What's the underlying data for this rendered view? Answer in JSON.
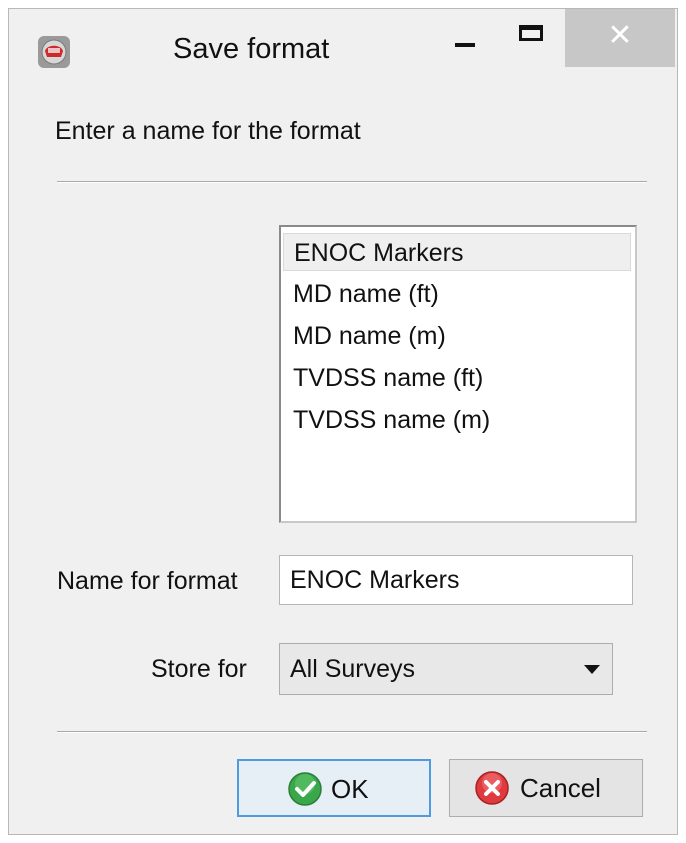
{
  "window": {
    "title": "Save format",
    "close_glyph": "✕"
  },
  "prompt": "Enter a name for the format",
  "format_list": {
    "items": [
      "ENOC Markers",
      "MD name (ft)",
      "MD name (m)",
      "TVDSS name (ft)",
      "TVDSS name (m)"
    ],
    "selected_index": 0
  },
  "name_field": {
    "label": "Name for format",
    "value": "ENOC Markers"
  },
  "store_field": {
    "label": "Store for",
    "value": "All Surveys"
  },
  "buttons": {
    "ok_label": "OK",
    "cancel_label": "Cancel"
  },
  "icons": {
    "app": "app-icon",
    "minimize": "minimize-icon",
    "maximize": "maximize-icon",
    "close": "close-icon",
    "ok": "checkmark-icon",
    "cancel": "cancel-icon",
    "dropdown": "chevron-down-icon"
  },
  "colors": {
    "close_button_bg": "#c7c7c7",
    "ok_icon": "#3aa84a",
    "cancel_icon": "#e0393e",
    "focus_border": "#4f9be0"
  }
}
